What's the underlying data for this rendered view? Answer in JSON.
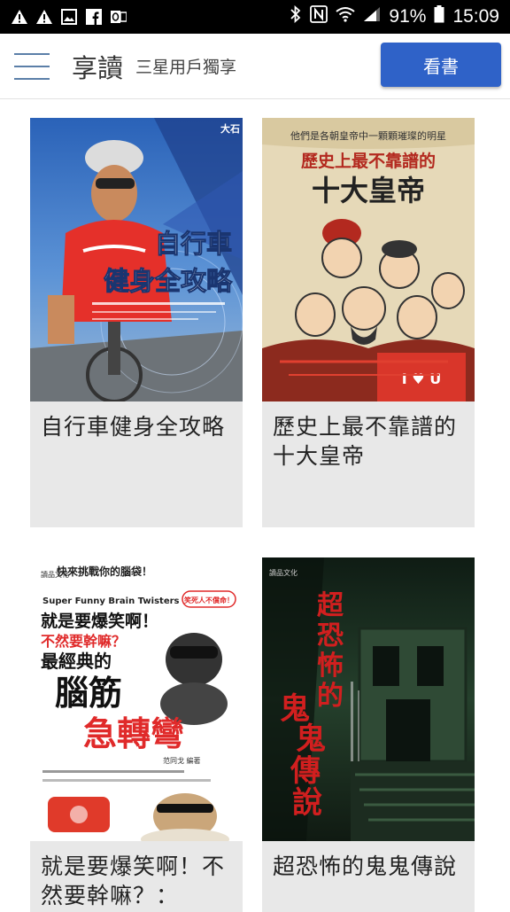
{
  "status_bar": {
    "battery_percent": "91%",
    "time": "15:09",
    "left_icons": [
      "warning-icon",
      "warning-icon",
      "image-icon",
      "facebook-icon",
      "outlook-icon"
    ],
    "right_icons": [
      "bluetooth-icon",
      "nfc-icon",
      "wifi-icon",
      "signal-icon",
      "battery-icon"
    ]
  },
  "header": {
    "title": "享讀",
    "subtitle": "三星用戶獨享",
    "read_button": "看書"
  },
  "books": [
    {
      "title": "自行車健身全攻略",
      "cover": {
        "headline_line1": "自行車",
        "headline_line2": "健身全攻略",
        "publisher": "大石",
        "colors": [
          "#1f4f9c",
          "#e23b2e"
        ]
      }
    },
    {
      "title": "歷史上最不靠譜的十大皇帝",
      "cover": {
        "tagline": "他們是各朝皇帝中一顆顆璀璨的明星",
        "headline_line1": "歷史上最不靠譜的",
        "headline_line2": "十大皇帝",
        "badge": "I ♥ U",
        "colors": [
          "#e6d9b8",
          "#b3291f"
        ]
      }
    },
    {
      "title": "就是要爆笑啊！不然要幹嘛？：",
      "cover": {
        "top_line": "快來挑戰你的腦袋！",
        "english": "Super Funny Brain Twisters",
        "line1": "就是要爆笑啊！",
        "line2": "不然要幹嘛？",
        "line3": "最經典的",
        "big1": "腦筋",
        "big2": "急轉彎",
        "bubble": "笑死人不償命！",
        "author": "范同戈 編著",
        "publisher": "讀品文化",
        "colors": [
          "#ffffff",
          "#e02a2a"
        ]
      }
    },
    {
      "title": "超恐怖的鬼鬼傳說",
      "cover": {
        "line1": "超恐怖的",
        "line2": "鬼鬼傳說",
        "publisher": "讀品文化",
        "colors": [
          "#14241a",
          "#d11f1f"
        ]
      }
    }
  ]
}
